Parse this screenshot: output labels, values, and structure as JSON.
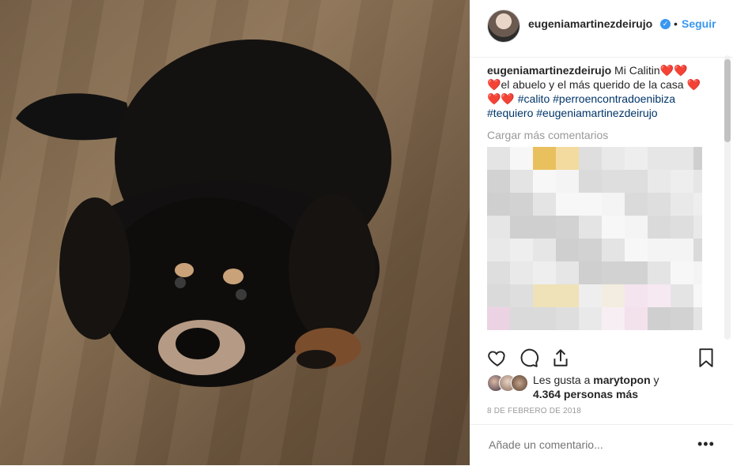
{
  "post": {
    "username": "eugeniamartinezdeirujo",
    "follow_label": "Seguir",
    "dot": "•",
    "verified_mark": "✓"
  },
  "caption": {
    "username": "eugeniamartinezdeirujo",
    "text_start": "Mi Calitin",
    "hearts_a": "❤️❤️",
    "hearts_b": "❤️",
    "text_mid": "el abuelo y el más querido de la casa",
    "hearts_c": "❤️❤️❤️",
    "hashtags_1": "#calito #perroencontradoenibiza",
    "hashtags_2": "#tequiero #eugeniamartinezdeirujo"
  },
  "load_more_label": "Cargar más comentarios",
  "likes": {
    "prefix": "Les gusta a",
    "user": "marytopon",
    "conj": "y",
    "others": "4.364 personas más"
  },
  "date": "8 DE FEBRERO DE 2018",
  "add_comment_placeholder": "Añade un comentario...",
  "more_options_label": "•••",
  "icons": [
    "heart-icon",
    "comment-icon",
    "share-icon",
    "bookmark-icon",
    "verified-icon"
  ],
  "colors": {
    "accent": "#3897f0",
    "hashtag": "#003569",
    "muted": "#999999"
  }
}
